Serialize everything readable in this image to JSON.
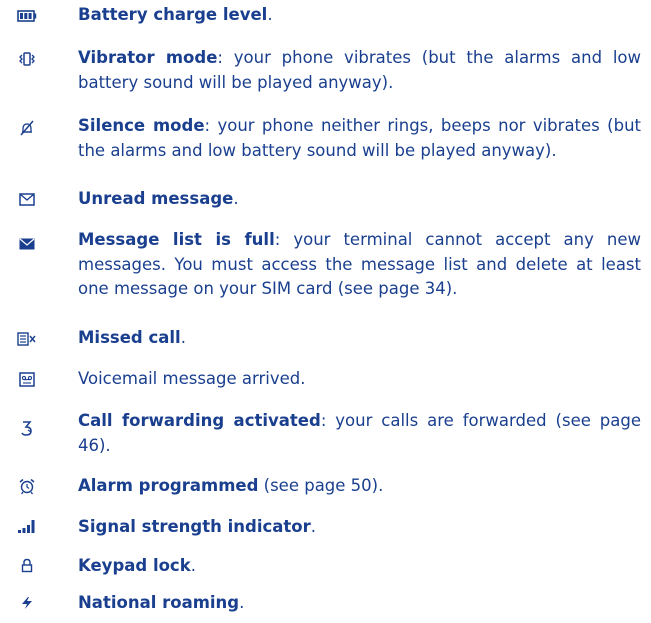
{
  "items": [
    {
      "icon": "battery-icon",
      "title": "Battery charge level",
      "text": "."
    },
    {
      "icon": "vibrate-icon",
      "title": "Vibrator mode",
      "text": ": your phone vibrates (but the alarms and low battery sound will be played anyway)."
    },
    {
      "icon": "silence-icon",
      "title": "Silence mode",
      "text": ": your phone neither rings, beeps nor vibrates (but the alarms and low battery sound will be played anyway)."
    },
    {
      "icon": "envelope-open-icon",
      "title": "Unread message",
      "text": "."
    },
    {
      "icon": "envelope-full-icon",
      "title": "Message list is full",
      "text": ": your terminal cannot accept any new messages. You must access the message list and delete at least one message on your SIM card (see page 34)."
    },
    {
      "icon": "missed-call-icon",
      "title": "Missed call",
      "text": "."
    },
    {
      "icon": "voicemail-icon",
      "title": "",
      "text": "Voicemail message arrived."
    },
    {
      "icon": "call-forward-icon",
      "title": "Call forwarding activated",
      "text": ": your calls are forwarded (see page 46)."
    },
    {
      "icon": "alarm-icon",
      "title": "Alarm programmed",
      "text": " (see page 50)."
    },
    {
      "icon": "signal-icon",
      "title": "Signal strength indicator",
      "text": "."
    },
    {
      "icon": "lock-icon",
      "title": "Keypad lock",
      "text": "."
    },
    {
      "icon": "roaming-icon",
      "title": "National roaming",
      "text": "."
    }
  ]
}
